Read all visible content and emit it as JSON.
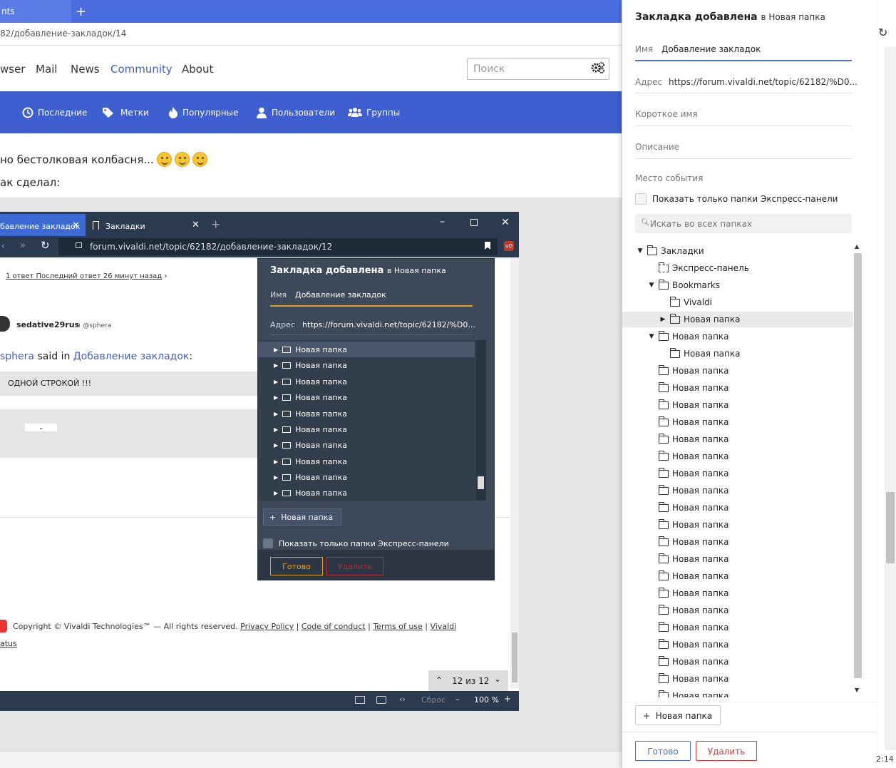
{
  "browser": {
    "tab_label": "nts",
    "address": "82/добавление-закладок/14",
    "clock": "2:14"
  },
  "site": {
    "nav": [
      "wser",
      "Mail",
      "News",
      "Community",
      "About"
    ],
    "search_placeholder": "Поиск",
    "menu": [
      "Последние",
      "Метки",
      "Популярные",
      "Пользователи",
      "Группы"
    ],
    "post_line1": "но бестолковая колбасня...",
    "post_line2": "ак сделал:"
  },
  "inner": {
    "tab1": "бавление закладок",
    "tab2": "Закладки",
    "url": "forum.vivaldi.net/topic/62182/добавление-закладок/12",
    "reply_meta": "1 ответ Последний ответ 26 минут назад",
    "user": "sedative29rus",
    "mention": "@sphera",
    "said_prefix": "sphera",
    "said_mid": "said in",
    "said_link": "Добавление закладок",
    "quote": "ОДНОЙ СТРОКОЙ !!!",
    "copyright_text": "Copyright © Vivaldi Technologies™ — All rights reserved.",
    "copyright_links": [
      "Privacy Policy",
      "Code of conduct",
      "Terms of use",
      "Vivaldi"
    ],
    "copyright_tail": "atus",
    "pager": "12 из 12",
    "status_reset": "Сброс",
    "status_zoom": "100 %",
    "dialog": {
      "title": "Закладка добавлена",
      "title_sub": "в Новая папка",
      "name_label": "Имя",
      "name_value": "Добавление закладок",
      "addr_label": "Адрес",
      "addr_value": "https://forum.vivaldi.net/topic/62182/%D0...",
      "folders": [
        "Новая папка",
        "Новая папка",
        "Новая папка",
        "Новая папка",
        "Новая папка",
        "Новая папка",
        "Новая папка",
        "Новая папка",
        "Новая папка",
        "Новая папка"
      ],
      "new_folder": "Новая папка",
      "checkbox": "Показать только папки Экспресс-панели",
      "done": "Готово",
      "delete": "Удалить"
    }
  },
  "panel": {
    "title": "Закладка добавлена",
    "title_sub": "в Новая папка",
    "name_label": "Имя",
    "name_value": "Добавление закладок",
    "addr_label": "Адрес",
    "addr_value": "https://forum.vivaldi.net/topic/62182/%D0...",
    "nick_label": "Короткое имя",
    "desc_label": "Описание",
    "location_label": "Место события",
    "checkbox": "Показать только папки Экспресс-панели",
    "search_placeholder": "Искать во всех папках",
    "tree": [
      {
        "label": "Закладки",
        "level": 0,
        "caret": "open"
      },
      {
        "label": "Экспресс-панель",
        "level": 1,
        "caret": "none",
        "special": true
      },
      {
        "label": "Bookmarks",
        "level": 1,
        "caret": "open"
      },
      {
        "label": "Vivaldi",
        "level": 2,
        "caret": "none"
      },
      {
        "label": "Новая папка",
        "level": 2,
        "caret": "closed",
        "selected": true
      },
      {
        "label": "Новая папка",
        "level": 1,
        "caret": "open"
      },
      {
        "label": "Новая папка",
        "level": 2,
        "caret": "none"
      },
      {
        "label": "Новая папка",
        "level": 1,
        "caret": "none"
      },
      {
        "label": "Новая папка",
        "level": 1,
        "caret": "none"
      },
      {
        "label": "Новая папка",
        "level": 1,
        "caret": "none"
      },
      {
        "label": "Новая папка",
        "level": 1,
        "caret": "none"
      },
      {
        "label": "Новая папка",
        "level": 1,
        "caret": "none"
      },
      {
        "label": "Новая папка",
        "level": 1,
        "caret": "none"
      },
      {
        "label": "Новая папка",
        "level": 1,
        "caret": "none"
      },
      {
        "label": "Новая папка",
        "level": 1,
        "caret": "none"
      },
      {
        "label": "Новая папка",
        "level": 1,
        "caret": "none"
      },
      {
        "label": "Новая папка",
        "level": 1,
        "caret": "none"
      },
      {
        "label": "Новая папка",
        "level": 1,
        "caret": "none"
      },
      {
        "label": "Новая папка",
        "level": 1,
        "caret": "none"
      },
      {
        "label": "Новая папка",
        "level": 1,
        "caret": "none"
      },
      {
        "label": "Новая папка",
        "level": 1,
        "caret": "none"
      },
      {
        "label": "Новая папка",
        "level": 1,
        "caret": "none"
      },
      {
        "label": "Новая папка",
        "level": 1,
        "caret": "none"
      },
      {
        "label": "Новая папка",
        "level": 1,
        "caret": "none"
      },
      {
        "label": "Новая папка",
        "level": 1,
        "caret": "none"
      },
      {
        "label": "Новая папка",
        "level": 1,
        "caret": "none"
      },
      {
        "label": "Новая папка",
        "level": 1,
        "caret": "none"
      },
      {
        "label": "Новая папка",
        "level": 1,
        "caret": "none"
      }
    ],
    "new_folder": "Новая папка",
    "done": "Готово",
    "delete": "Удалить"
  },
  "colors": {
    "brand": "#4a6ee0",
    "menu": "#3f5ecf",
    "dialog_dark": "#3d4858",
    "accent_orange": "#e0a020",
    "danger": "#d33333"
  }
}
